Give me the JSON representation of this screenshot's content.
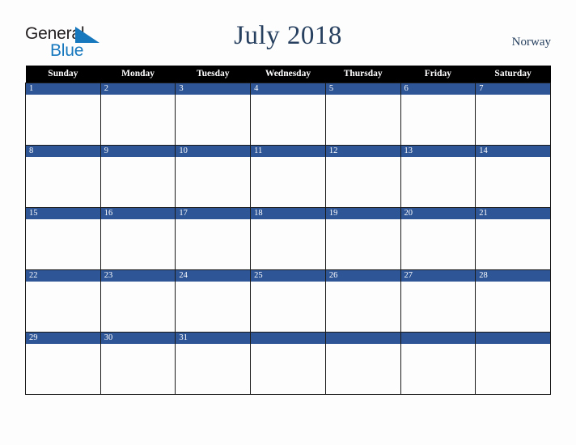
{
  "logo": {
    "text_top": "General",
    "text_bottom": "Blue",
    "triangle_icon": "blue-triangle-icon",
    "color_top": "#231f20",
    "color_bottom": "#1878be"
  },
  "header": {
    "title": "July 2018",
    "country": "Norway",
    "title_color": "#27405f"
  },
  "calendar": {
    "weekday_headers": [
      "Sunday",
      "Monday",
      "Tuesday",
      "Wednesday",
      "Thursday",
      "Friday",
      "Saturday"
    ],
    "header_bg": "#000000",
    "daynum_bg": "#2e5596",
    "cell_bg": "#fdfdfd",
    "weeks": [
      [
        "1",
        "2",
        "3",
        "4",
        "5",
        "6",
        "7"
      ],
      [
        "8",
        "9",
        "10",
        "11",
        "12",
        "13",
        "14"
      ],
      [
        "15",
        "16",
        "17",
        "18",
        "19",
        "20",
        "21"
      ],
      [
        "22",
        "23",
        "24",
        "25",
        "26",
        "27",
        "28"
      ],
      [
        "29",
        "30",
        "31",
        "",
        "",
        "",
        ""
      ]
    ]
  }
}
